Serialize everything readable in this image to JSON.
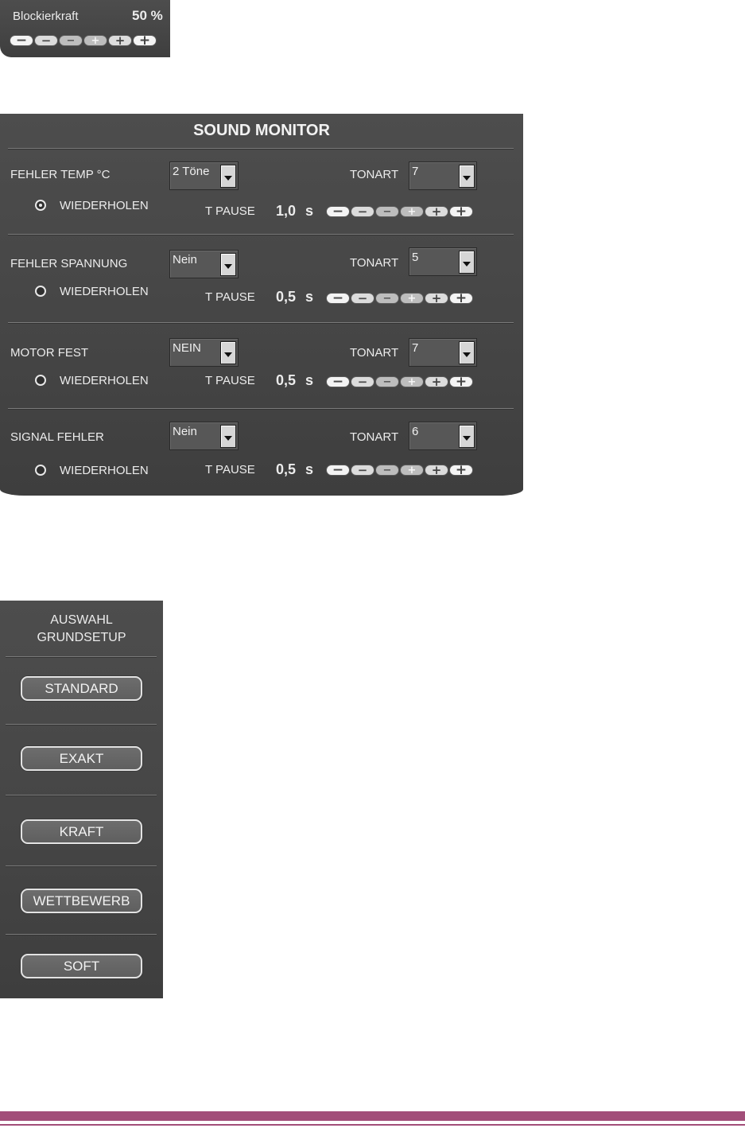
{
  "blockier": {
    "label": "Blockierkraft",
    "value": "50 %",
    "stepper": [
      "−",
      "−",
      "−",
      "+",
      "+",
      "+"
    ]
  },
  "sound_monitor": {
    "title": "SOUND MONITOR",
    "repeat_label": "WIEDERHOLEN",
    "tpause_label": "T PAUSE",
    "tonart_label": "TONART",
    "unit": "s",
    "rows": [
      {
        "name": "FEHLER TEMP °C",
        "mode": "2 Töne",
        "tonart": "7",
        "tpause": "1,0",
        "repeat_on": true
      },
      {
        "name": "FEHLER SPANNUNG",
        "mode": "Nein",
        "tonart": "5",
        "tpause": "0,5",
        "repeat_on": false
      },
      {
        "name": "MOTOR FEST",
        "mode": "NEIN",
        "tonart": "7",
        "tpause": "0,5",
        "repeat_on": false
      },
      {
        "name": "SIGNAL FEHLER",
        "mode": "Nein",
        "tonart": "6",
        "tpause": "0,5",
        "repeat_on": false
      }
    ]
  },
  "grundsetup": {
    "heading_line1": "AUSWAHL",
    "heading_line2": "GRUNDSETUP",
    "presets": [
      "STANDARD",
      "EXAKT",
      "KRAFT",
      "WETTBEWERB",
      "SOFT"
    ]
  },
  "colors": {
    "panel": "#464646",
    "text": "#ececec",
    "footer": "#a24e79"
  }
}
